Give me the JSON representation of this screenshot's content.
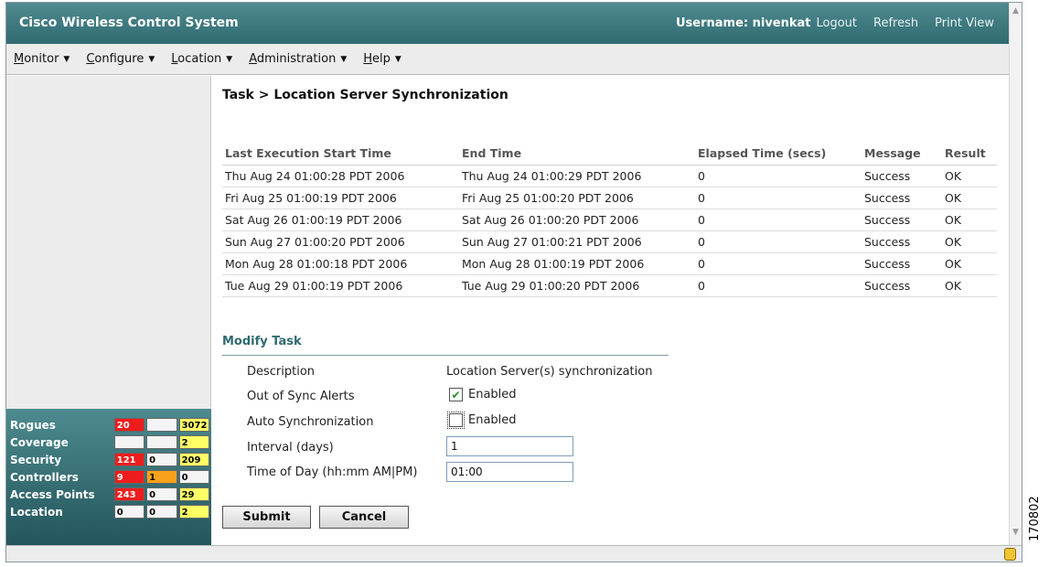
{
  "header": {
    "app_title": "Cisco Wireless Control System",
    "username": "Username: nivenkat",
    "logout": "Logout",
    "refresh": "Refresh",
    "print_view": "Print View"
  },
  "menu": [
    {
      "first": "M",
      "rest": "onitor"
    },
    {
      "first": "C",
      "rest": "onfigure"
    },
    {
      "first": "L",
      "rest": "ocation"
    },
    {
      "first": "A",
      "rest": "dministration"
    },
    {
      "first": "H",
      "rest": "elp"
    }
  ],
  "alarms": {
    "rows": [
      {
        "label": "Rogues",
        "c1": "20",
        "c2": "",
        "c3": "3072"
      },
      {
        "label": "Coverage",
        "c1": "",
        "c2": "",
        "c3": "2"
      },
      {
        "label": "Security",
        "c1": "121",
        "c2": "0",
        "c3": "209"
      },
      {
        "label": "Controllers",
        "c1": "9",
        "c2": "1",
        "c3": "0"
      },
      {
        "label": "Access Points",
        "c1": "243",
        "c2": "0",
        "c3": "29"
      },
      {
        "label": "Location",
        "c1": "0",
        "c2": "0",
        "c3": "2"
      }
    ],
    "colors": {
      "critical": "#ee1c1c",
      "major": "#f6a21a",
      "minor": "#ffff66",
      "none": "#f4f4f4"
    }
  },
  "page": {
    "title": "Task > Location Server Synchronization"
  },
  "history": {
    "columns": [
      "Last Execution Start Time",
      "End Time",
      "Elapsed Time (secs)",
      "Message",
      "Result"
    ],
    "rows": [
      [
        "Thu Aug 24 01:00:28 PDT 2006",
        "Thu Aug 24 01:00:29 PDT 2006",
        "0",
        "Success",
        "OK"
      ],
      [
        "Fri Aug 25 01:00:19 PDT 2006",
        "Fri Aug 25 01:00:20 PDT 2006",
        "0",
        "Success",
        "OK"
      ],
      [
        "Sat Aug 26 01:00:19 PDT 2006",
        "Sat Aug 26 01:00:20 PDT 2006",
        "0",
        "Success",
        "OK"
      ],
      [
        "Sun Aug 27 01:00:20 PDT 2006",
        "Sun Aug 27 01:00:21 PDT 2006",
        "0",
        "Success",
        "OK"
      ],
      [
        "Mon Aug 28 01:00:18 PDT 2006",
        "Mon Aug 28 01:00:19 PDT 2006",
        "0",
        "Success",
        "OK"
      ],
      [
        "Tue Aug 29 01:00:19 PDT 2006",
        "Tue Aug 29 01:00:20 PDT 2006",
        "0",
        "Success",
        "OK"
      ]
    ]
  },
  "modify": {
    "title": "Modify Task",
    "description_label": "Description",
    "description_value": "Location Server(s) synchronization",
    "out_of_sync_label": "Out of Sync Alerts",
    "out_of_sync_checked": true,
    "out_of_sync_text": "Enabled",
    "auto_sync_label": "Auto Synchronization",
    "auto_sync_checked": false,
    "auto_sync_text": "Enabled",
    "interval_label": "Interval (days)",
    "interval_value": "1",
    "time_label": "Time of Day (hh:mm AM|PM)",
    "time_value": "01:00",
    "submit": "Submit",
    "cancel": "Cancel"
  },
  "figure_id": "170802"
}
